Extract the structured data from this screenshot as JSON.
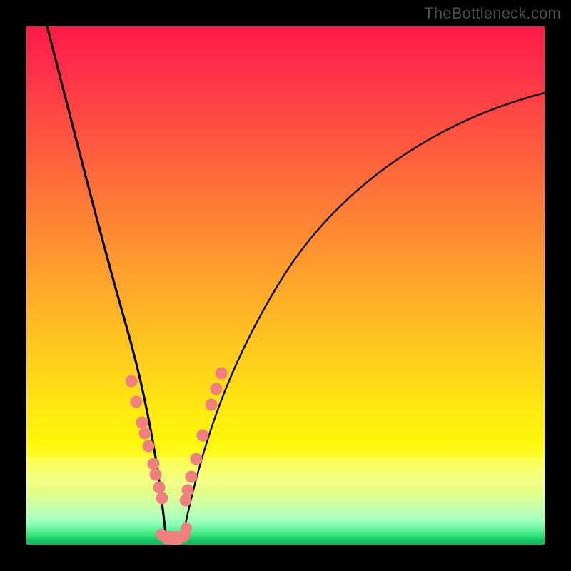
{
  "watermark": "TheBottleneck.com",
  "colors": {
    "frame": "#000000",
    "curve": "#000000",
    "marker": "#f08080",
    "gradient_top": "#ff1a48",
    "gradient_bottom": "#10b85e"
  },
  "chart_data": {
    "type": "line",
    "title": "",
    "xlabel": "",
    "ylabel": "",
    "xlim": [
      0,
      100
    ],
    "ylim": [
      0,
      100
    ],
    "grid": false,
    "notes": "V-shaped bottleneck curve over red-to-green vertical gradient; axes unlabeled. Values estimated from pixel positions.",
    "series": [
      {
        "name": "left-branch",
        "x": [
          4.0,
          6.0,
          8.0,
          10.0,
          12.5,
          15.0,
          17.0,
          19.0,
          20.5,
          21.5,
          22.5,
          23.3,
          24.0,
          24.6,
          25.1,
          25.5,
          25.9,
          26.2,
          26.5
        ],
        "y": [
          100.0,
          86.0,
          74.0,
          63.0,
          50.5,
          39.5,
          31.5,
          24.5,
          19.5,
          16.5,
          13.5,
          11.0,
          9.0,
          7.3,
          5.8,
          4.5,
          3.4,
          2.5,
          1.7
        ]
      },
      {
        "name": "right-branch",
        "x": [
          30.0,
          30.6,
          31.5,
          32.5,
          34.0,
          36.0,
          38.5,
          42.0,
          46.5,
          52.0,
          59.0,
          67.0,
          76.0,
          86.0,
          97.0,
          100.0
        ],
        "y": [
          1.7,
          3.6,
          6.2,
          9.1,
          12.8,
          17.3,
          22.5,
          28.8,
          35.8,
          43.0,
          50.8,
          58.5,
          65.8,
          72.3,
          78.0,
          79.5
        ]
      },
      {
        "name": "valley-floor",
        "x": [
          26.5,
          27.0,
          27.6,
          28.2,
          28.8,
          29.4,
          30.0
        ],
        "y": [
          1.7,
          1.1,
          0.8,
          0.7,
          0.8,
          1.1,
          1.7
        ]
      }
    ],
    "markers": {
      "name": "highlighted-points",
      "color": "#f08080",
      "radius_percent": 1.15,
      "points": [
        {
          "x": 20.3,
          "y": 31.5
        },
        {
          "x": 21.3,
          "y": 27.5
        },
        {
          "x": 22.4,
          "y": 23.5
        },
        {
          "x": 22.9,
          "y": 21.5
        },
        {
          "x": 23.6,
          "y": 19.0
        },
        {
          "x": 24.6,
          "y": 15.5
        },
        {
          "x": 25.0,
          "y": 13.5
        },
        {
          "x": 25.7,
          "y": 11.0
        },
        {
          "x": 26.2,
          "y": 9.0
        },
        {
          "x": 30.7,
          "y": 8.5
        },
        {
          "x": 31.2,
          "y": 10.5
        },
        {
          "x": 31.9,
          "y": 13.0
        },
        {
          "x": 32.8,
          "y": 16.5
        },
        {
          "x": 34.0,
          "y": 21.0
        },
        {
          "x": 35.7,
          "y": 27.0
        },
        {
          "x": 36.6,
          "y": 30.0
        },
        {
          "x": 37.6,
          "y": 33.0
        }
      ]
    },
    "valley_blob": {
      "name": "valley-marker-cluster",
      "color": "#f08080",
      "x_range": [
        25.5,
        31.2
      ],
      "y_range": [
        0.5,
        3.6
      ]
    },
    "pale_bands_y": [
      14.3,
      15.8,
      17.3,
      18.8
    ]
  }
}
